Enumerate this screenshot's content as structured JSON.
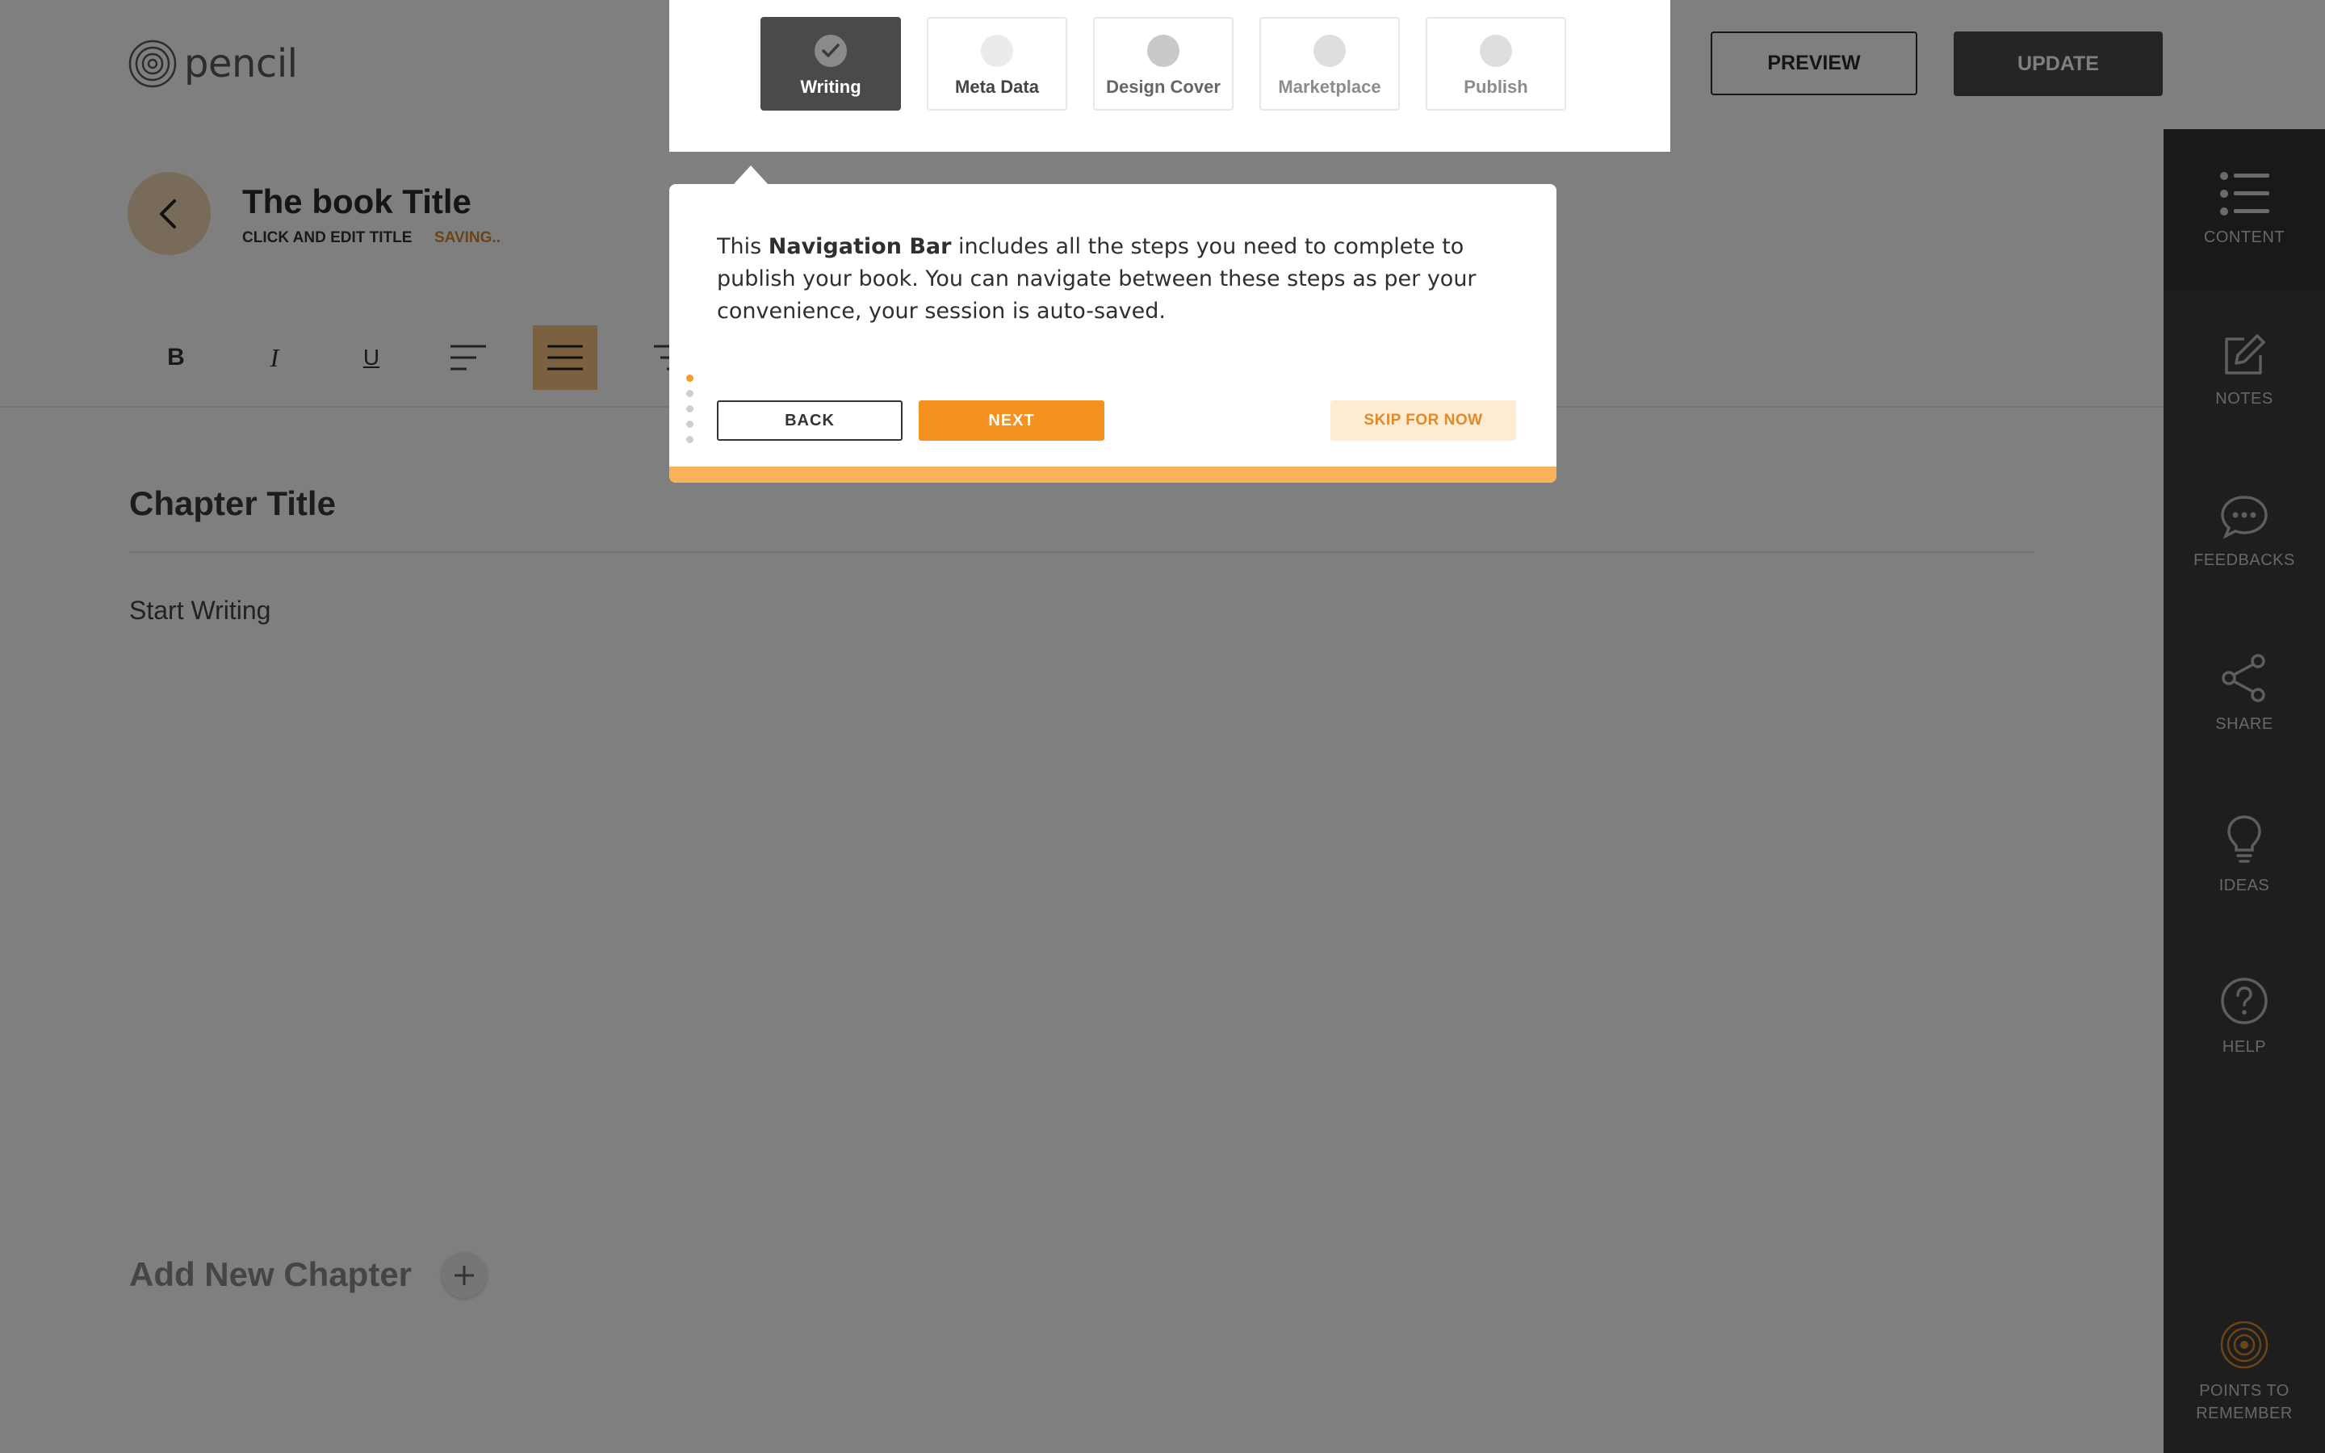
{
  "brand": {
    "name": "pencil",
    "icon": "pencil-logo-icon"
  },
  "header": {
    "preview_label": "PREVIEW",
    "update_label": "UPDATE"
  },
  "steps": [
    {
      "label": "Writing",
      "state": "done",
      "icon": "check-icon"
    },
    {
      "label": "Meta Data",
      "state": "pending"
    },
    {
      "label": "Design Cover",
      "state": "pending"
    },
    {
      "label": "Marketplace",
      "state": "pending"
    },
    {
      "label": "Publish",
      "state": "pending"
    }
  ],
  "book": {
    "title": "The book Title",
    "edit_hint": "CLICK AND EDIT TITLE",
    "status": "SAVING..",
    "back_icon": "chevron-left-icon"
  },
  "toolbar": {
    "bold": "B",
    "italic": "I",
    "underline": "U",
    "icons": [
      "bold-icon",
      "italic-icon",
      "underline-icon",
      "align-left-icon",
      "align-center-icon",
      "align-right-icon"
    ]
  },
  "editor": {
    "chapter_title": "Chapter Title",
    "placeholder": "Start Writing",
    "add_chapter": "Add New Chapter",
    "add_icon": "plus-icon"
  },
  "sidebar": {
    "items": [
      {
        "label": "CONTENT",
        "icon": "list-icon"
      },
      {
        "label": "NOTES",
        "icon": "edit-note-icon"
      },
      {
        "label": "FEEDBACKS",
        "icon": "chat-bubble-icon"
      },
      {
        "label": "SHARE",
        "icon": "share-icon"
      },
      {
        "label": "IDEAS",
        "icon": "lightbulb-icon"
      },
      {
        "label": "HELP",
        "icon": "help-circle-icon"
      },
      {
        "label": "POINTS TO REMEMBER",
        "icon": "target-icon"
      }
    ]
  },
  "tooltip": {
    "text_before": "This ",
    "text_bold": "Navigation Bar",
    "text_after": " includes all the steps you need to complete to publish your book. You can navigate between these steps as per your convenience, your session is auto-saved.",
    "back_label": "BACK",
    "next_label": "NEXT",
    "skip_label": "SKIP FOR NOW",
    "current_step": 1,
    "total_steps": 5
  },
  "colors": {
    "accent": "#f5911e",
    "dark": "#4a4a4a",
    "sidebar": "#3c3c3c",
    "overlay": "rgba(0,0,0,0.5)"
  }
}
